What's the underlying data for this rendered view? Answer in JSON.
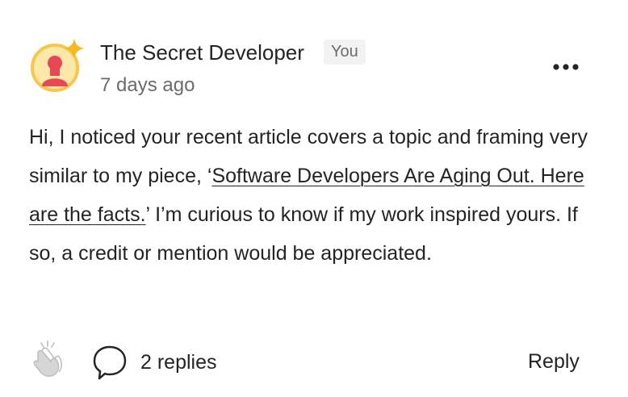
{
  "comment": {
    "author_name": "The Secret Developer",
    "author_badge": "You",
    "timestamp": "7 days ago",
    "body": {
      "text_before_link": "Hi, I noticed your recent article covers a topic and framing very similar to my piece, ‘",
      "link_text": "Software Developers Are Aging Out. Here are the facts.",
      "text_after_link": "’ I’m curious to know if my work inspired yours. If so, a credit or mention would be appreciated."
    }
  },
  "actions": {
    "replies_label": "2 replies",
    "reply_button": "Reply"
  },
  "icons": {
    "avatar": "user-avatar-icon",
    "sparkle": "sparkle-icon",
    "more": "more-options-icon",
    "clap": "clap-icon",
    "comment": "comment-bubble-icon"
  },
  "colors": {
    "avatar_ring": "#F5C84B",
    "avatar_person": "#E84855",
    "sparkle": "#F5B820",
    "muted_text": "#6B6B6B",
    "text": "#242424",
    "badge_bg": "#F2F2F2"
  }
}
